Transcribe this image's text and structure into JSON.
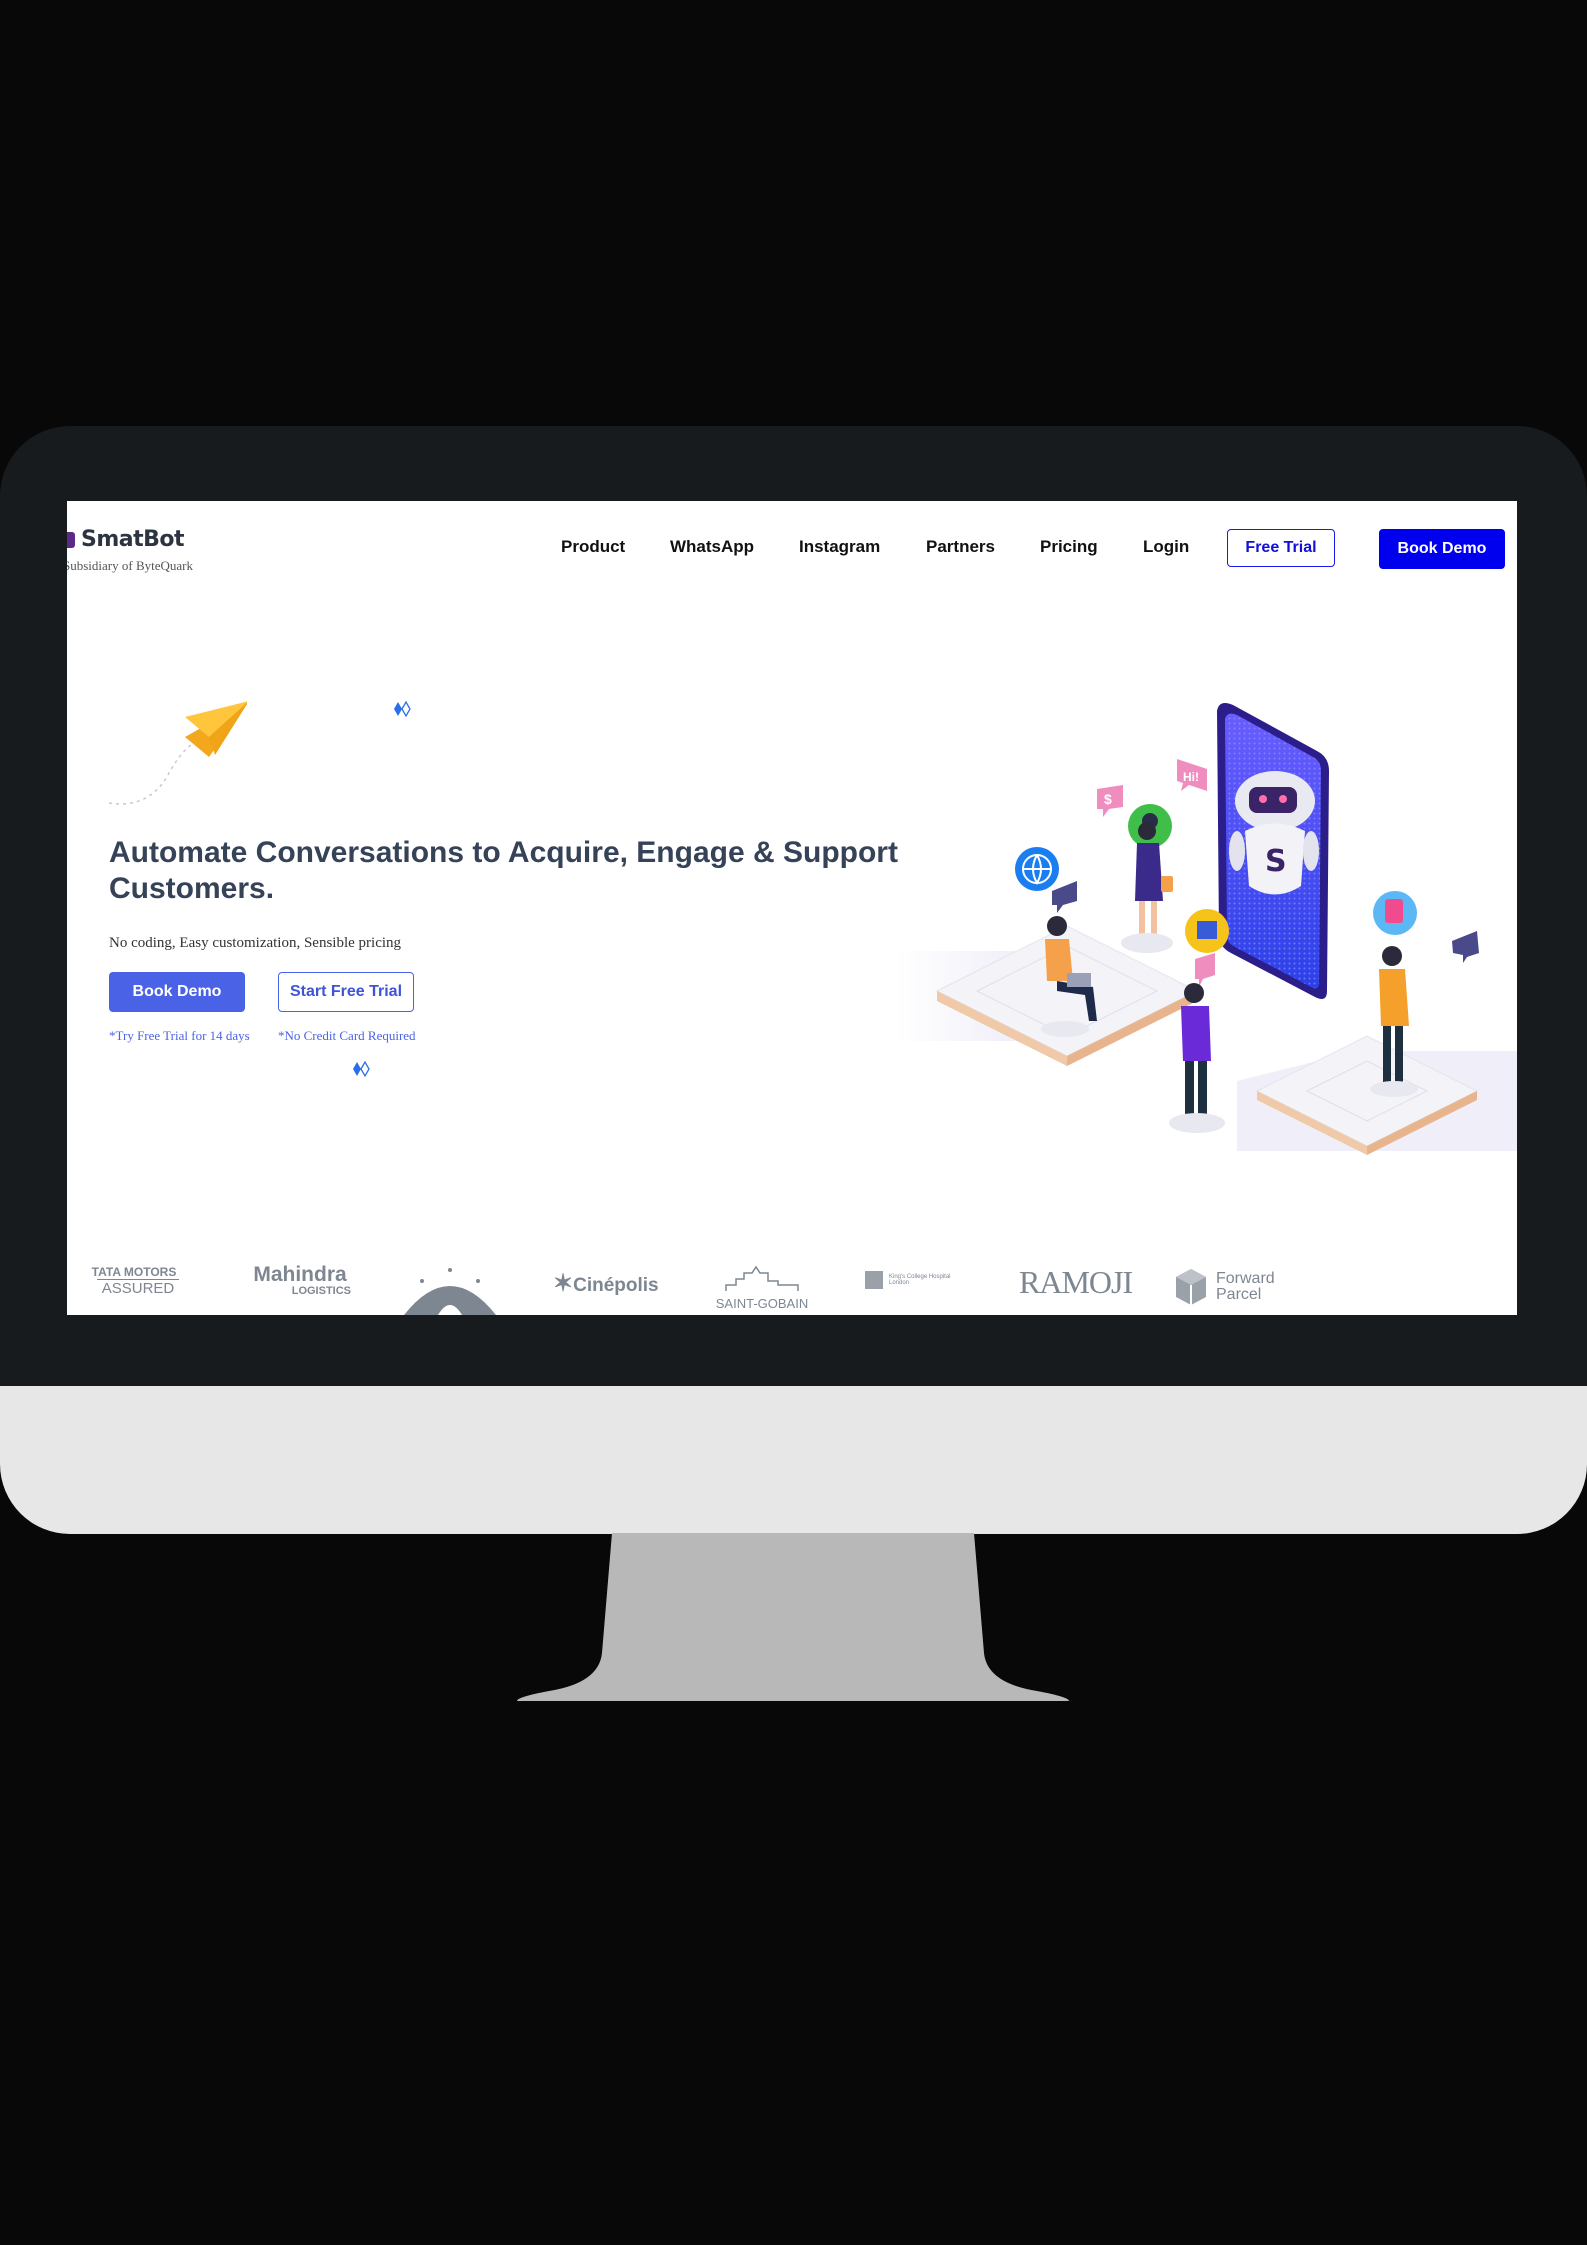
{
  "brand": {
    "name": "SmatBot",
    "subsidiary": "Subsidiary of ByteQuark"
  },
  "nav": {
    "items": [
      "Product",
      "WhatsApp",
      "Instagram",
      "Partners",
      "Pricing",
      "Login"
    ],
    "free_trial": "Free Trial",
    "book_demo": "Book Demo"
  },
  "hero": {
    "headline": "Automate Conversations to Acquire, Engage & Support Customers.",
    "tagline": "No coding, Easy customization, Sensible pricing",
    "book_demo": "Book Demo",
    "start_trial": "Start Free Trial",
    "note_trial": "*Try Free Trial for 14 days",
    "note_card": "*No Credit Card Required"
  },
  "illustration": {
    "bubble_hi": "Hi!",
    "bubble_dollar": "$",
    "robot_badge": "S"
  },
  "clients": {
    "tata_1": "TATA MOTORS",
    "tata_2": "ASSURED",
    "mahindra_1": "Mahindra",
    "mahindra_2": "LOGISTICS",
    "cinepolis": "Cinépolis",
    "saint_gobain": "SAINT-GOBAIN",
    "kings_college": "King's College Hospital London",
    "ramoji": "RAMOJI",
    "forward_1": "Forward",
    "forward_2": "Parcel"
  },
  "colors": {
    "primary": "#4a63e6",
    "nav_cta": "#0000ee",
    "headline": "#354258",
    "bezel": "#171b1e"
  }
}
